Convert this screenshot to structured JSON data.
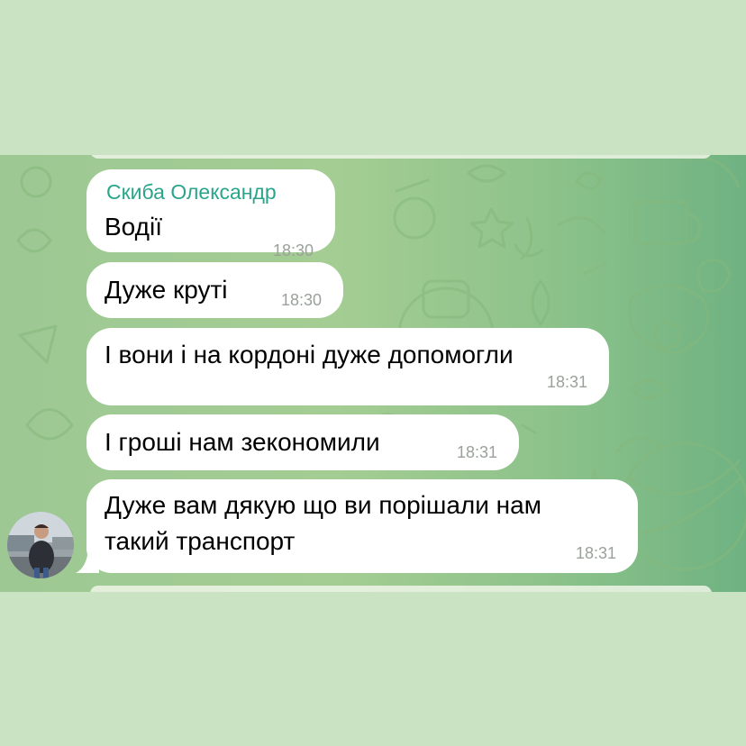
{
  "chat": {
    "sender_name": "Скиба Олександр",
    "messages": [
      {
        "lines": [
          "Водії"
        ],
        "time": "18:30"
      },
      {
        "lines": [
          "Дуже круті"
        ],
        "time": "18:30"
      },
      {
        "lines": [
          "І вони і на кордоні дуже допомогли"
        ],
        "time": "18:31"
      },
      {
        "lines": [
          "І гроші нам зекономили"
        ],
        "time": "18:31"
      },
      {
        "lines": [
          "Дуже вам дякую що ви порішали нам",
          "такий транспорт"
        ],
        "time": "18:31"
      }
    ]
  },
  "colors": {
    "sender_name": "#2aa58c",
    "bubble": "#ffffff",
    "timestamp": "#9aa19a",
    "outer_background": "#c9e3c3",
    "chat_background": "#a4cd93"
  },
  "icons": [
    "avatar"
  ]
}
